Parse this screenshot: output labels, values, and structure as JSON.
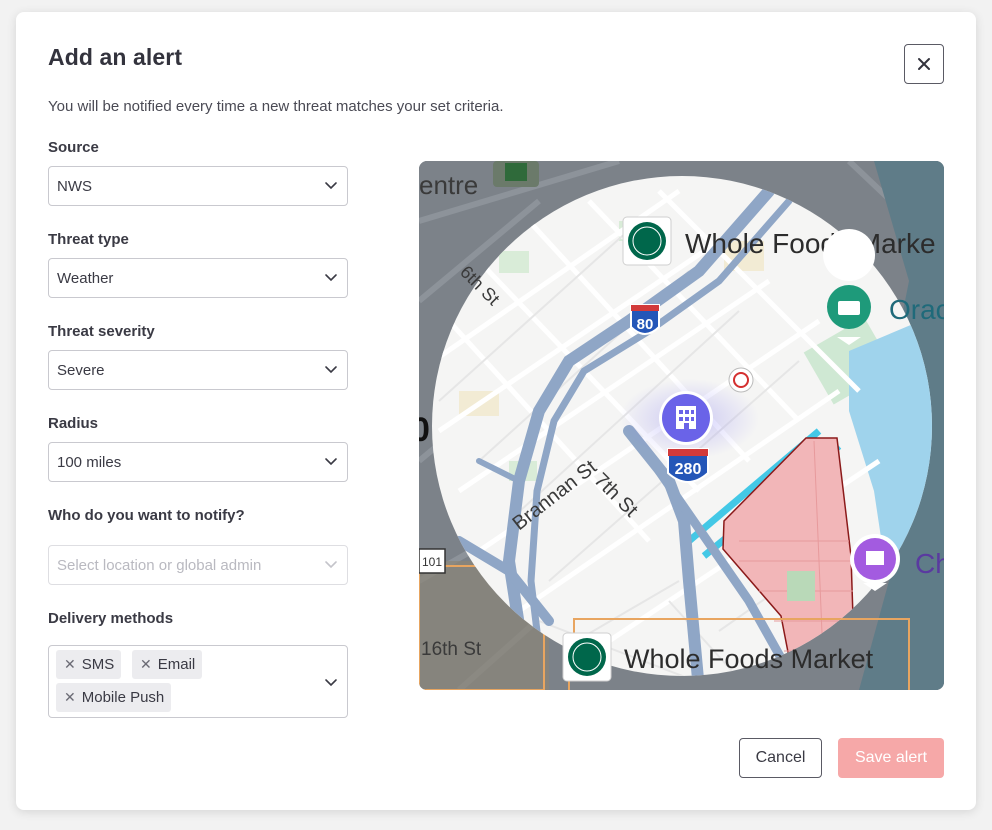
{
  "dialog": {
    "title": "Add an alert",
    "subtitle": "You will be notified every time a new threat matches your set criteria."
  },
  "form": {
    "source": {
      "label": "Source",
      "value": "NWS"
    },
    "threat_type": {
      "label": "Threat type",
      "value": "Weather"
    },
    "threat_severity": {
      "label": "Threat severity",
      "value": "Severe"
    },
    "radius": {
      "label": "Radius",
      "value": "100 miles"
    },
    "notify": {
      "label": "Who do you want to notify?",
      "placeholder": "Select location or global admin"
    },
    "delivery": {
      "label": "Delivery methods",
      "chips": [
        "SMS",
        "Email",
        "Mobile Push"
      ]
    }
  },
  "map": {
    "labels": {
      "centre": "entre",
      "whole_foods_top": "Whole Foods Marke",
      "whole_foods_bottom": "Whole Foods Market",
      "oracle": "Orac",
      "sixth_st": "6th St",
      "seventh_st": "7th St",
      "brannan_st": "Brannan St",
      "sixteenth_st": "16th St",
      "ch": "Ch",
      "zero": "0",
      "hwy_101": "101"
    },
    "shields": {
      "i80": "80",
      "i280": "280"
    },
    "colors": {
      "radius_circle": "#f5f5f4",
      "freeway": "#8fa6c6",
      "zone_fill": "#f2b6b8",
      "zone_stroke": "#8b1a1a",
      "pin": "#6a63e8",
      "water": "#9fd3ec"
    }
  },
  "actions": {
    "cancel": "Cancel",
    "save": "Save alert"
  },
  "icons": {
    "close": "close-icon",
    "chevron": "chevron-down-icon",
    "chip_remove": "remove-icon",
    "building": "building-icon"
  }
}
